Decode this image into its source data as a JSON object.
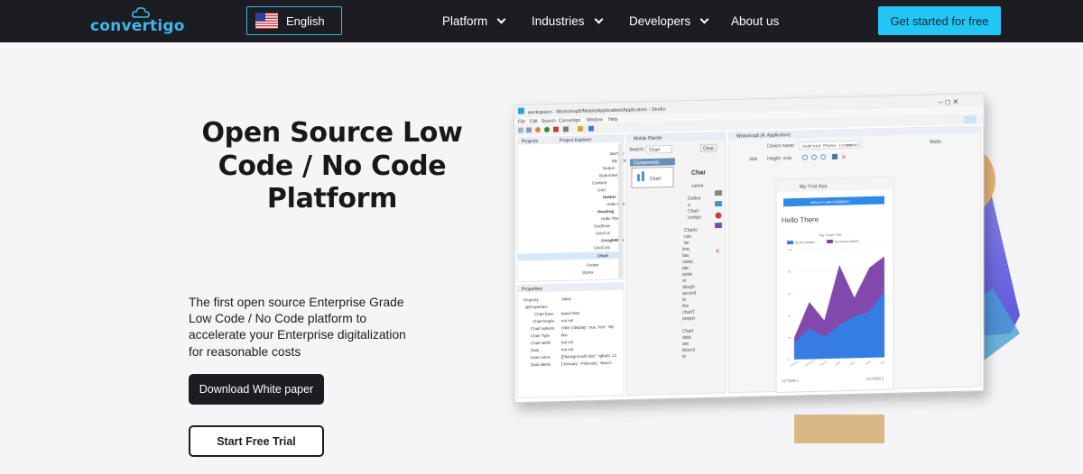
{
  "nav": {
    "logo_text": "convertigo",
    "language": "English",
    "menu": [
      {
        "label": "Platform"
      },
      {
        "label": "Industries"
      },
      {
        "label": "Developers"
      },
      {
        "label": "About us"
      }
    ],
    "cta_label": "Get started for free"
  },
  "hero": {
    "title_lines": [
      "Open Source Low",
      "Code / No Code",
      "Platform"
    ],
    "description": "The first open source Enterprise Grade Low Code / No Code platform to accelerate your Enterprise digitalization for reasonable costs",
    "primary_button": "Download White paper",
    "secondary_button": "Start Free Trial"
  },
  "studio": {
    "window_title": "workspace - Workshop5/MobileApplication/Application - Studio",
    "menubar": [
      "File",
      "Edit",
      "Search",
      "Convertigo",
      "Window",
      "Help"
    ],
    "projects_tab": "Projects",
    "explorer_tab": "Project Explorer",
    "tree_items": [
      "BarTele",
      "My First App",
      "Button",
      "ButtonSet",
      "Content",
      "Grid",
      "Button",
      "Hello Low Codes !",
      "Heading",
      "Hello There",
      "GridRow",
      "GridCol",
      "GoogleMap",
      "GridCol1",
      "Chart",
      "Footer",
      "Styles"
    ],
    "properties_tab": "Properties",
    "prop_header": [
      "Property",
      "Value"
    ],
    "props": [
      [
        "@Properties",
        ""
      ],
      [
        "Chart base",
        "baseChart"
      ],
      [
        "Chart height",
        "not set"
      ],
      [
        "Chart options",
        "{'title':{'display': true, 'text': 'My"
      ],
      [
        "Chart Type",
        "line"
      ],
      [
        "Chart width",
        "not set"
      ],
      [
        "Data",
        "not set"
      ],
      [
        "Data colors",
        "[{'backgroundColor': 'rgba(0, 12"
      ],
      [
        "Data labels",
        "['January', 'February', 'March"
      ]
    ],
    "palette_tab": "Mobile Palette",
    "search_label": "Search:",
    "search_value": "Chart",
    "clear_label": "Clear",
    "components_label": "Components",
    "chart_component": "Chart",
    "doc_heading": "Char",
    "doc_text": [
      "canva",
      "Define",
      "a",
      "Chart",
      "compo",
      "Charts",
      "can",
      "be",
      "line,",
      "bar,",
      "radar,",
      "pie,",
      "polar",
      "or",
      "dough",
      "accord",
      "to",
      "the",
      "chartT",
      "proper",
      "Chart",
      "data",
      "are",
      "bound",
      "to"
    ],
    "app_tab": "Workshop5 [A: Application]",
    "device_label": "Device name:",
    "device_value": "Android Phone (common)",
    "width_label": "Width:",
    "width_value": "360",
    "height_label": "Height:",
    "height_value": "640",
    "phone": {
      "title": "My First App",
      "button": "HELLO LOW CODENS !",
      "heading": "Hello There",
      "chart_title": "My Chart Title",
      "legend": [
        "My first dataset",
        "My second dataset"
      ],
      "footer_left": "ACTION 1",
      "footer_right": "ACTION 2"
    }
  },
  "colors": {
    "nav_bg": "#1b1d22",
    "accent": "#22c6f4",
    "series_1": "#2f7fe6",
    "series_2": "#7b3fa8"
  },
  "chart_data": {
    "type": "area",
    "title": "My Chart Title",
    "categories": [
      "January",
      "February",
      "March",
      "April",
      "May",
      "June",
      "July"
    ],
    "series": [
      {
        "name": "My first dataset",
        "values": [
          15,
          28,
          20,
          30,
          38,
          42,
          60
        ]
      },
      {
        "name": "My second dataset",
        "values": [
          20,
          52,
          35,
          85,
          55,
          82,
          92
        ]
      }
    ],
    "ylim": [
      0,
      100
    ]
  }
}
